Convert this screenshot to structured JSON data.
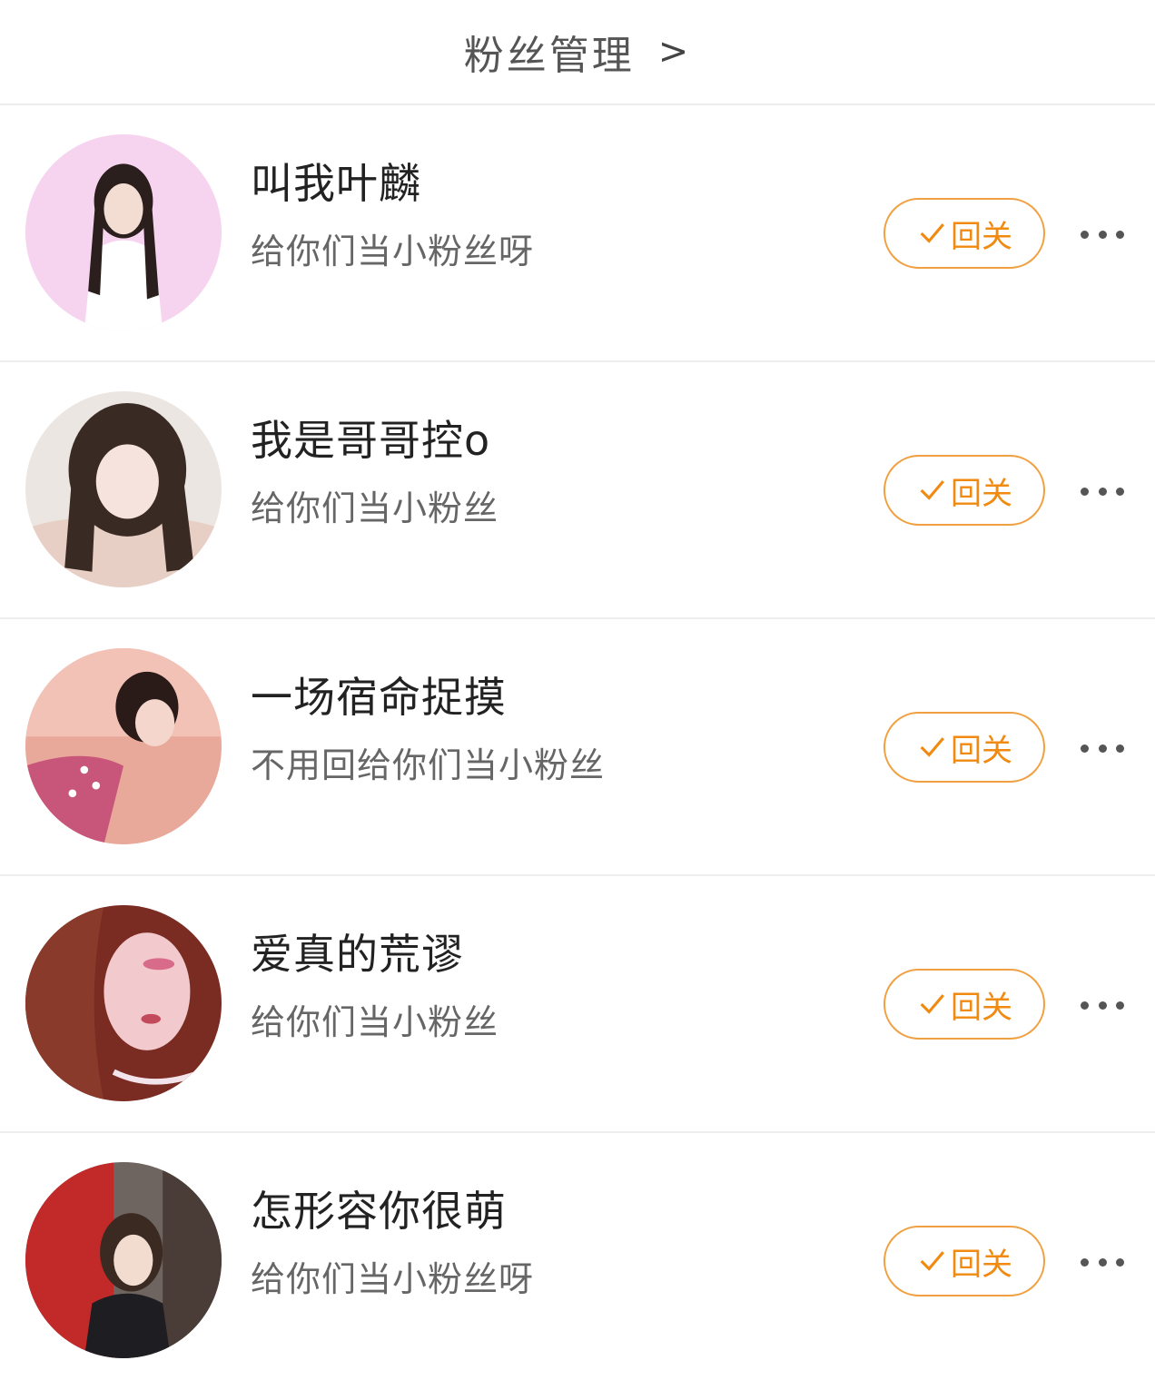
{
  "header": {
    "title": "粉丝管理",
    "chevron": ">"
  },
  "fans": [
    {
      "name": "叫我叶麟",
      "bio": "给你们当小粉丝呀",
      "button": "回关",
      "avatar_icon": "avatar-photo"
    },
    {
      "name": "我是哥哥控o",
      "bio": "给你们当小粉丝",
      "button": "回关",
      "avatar_icon": "avatar-photo"
    },
    {
      "name": "一场宿命捉摸",
      "bio": "不用回给你们当小粉丝",
      "button": "回关",
      "avatar_icon": "avatar-photo"
    },
    {
      "name": "爱真的荒谬",
      "bio": "给你们当小粉丝",
      "button": "回关",
      "avatar_icon": "avatar-photo"
    },
    {
      "name": "怎形容你很萌",
      "bio": "给你们当小粉丝呀",
      "button": "回关",
      "avatar_icon": "avatar-photo"
    }
  ],
  "colors": {
    "accent": "#f08a10",
    "button_border": "#f0a040",
    "divider": "#eeeeee"
  }
}
